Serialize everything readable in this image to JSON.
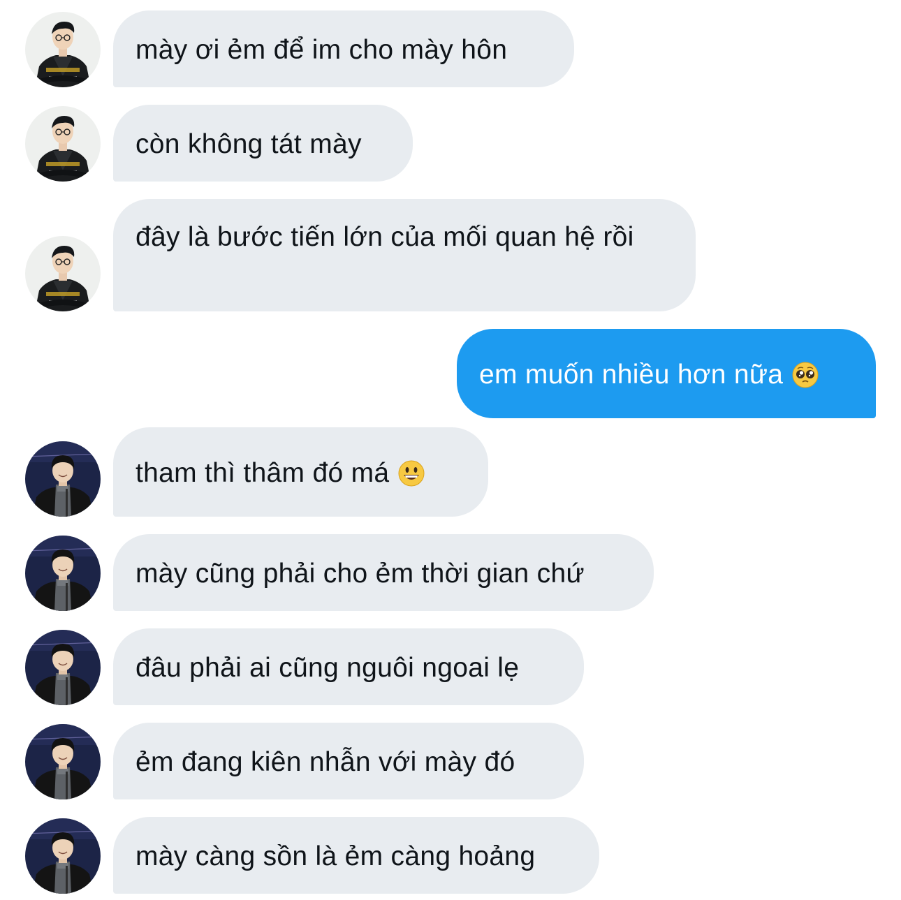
{
  "conversation": {
    "messages": [
      {
        "sender": "contact-a",
        "text": "mày ơi ẻm để im cho mày hôn"
      },
      {
        "sender": "contact-a",
        "text": "còn không tát mày"
      },
      {
        "sender": "contact-a",
        "text": "đây là bước tiến lớn của mối quan hệ rồi"
      },
      {
        "sender": "self",
        "text": "em muốn nhiều hơn nữa",
        "emoji": "pleading-face-emoji"
      },
      {
        "sender": "contact-b",
        "text": "tham thì thâm đó má",
        "emoji": "grinning-face-emoji"
      },
      {
        "sender": "contact-b",
        "text": "mày cũng phải cho ẻm thời gian chứ"
      },
      {
        "sender": "contact-b",
        "text": "đâu phải ai cũng nguôi ngoai lẹ"
      },
      {
        "sender": "contact-b",
        "text": "ẻm đang kiên nhẫn với mày đó"
      },
      {
        "sender": "contact-b",
        "text": "mày càng sồn là ẻm càng hoảng"
      }
    ]
  },
  "colors": {
    "incoming_bubble": "#e8ecf0",
    "outgoing_bubble": "#1d9bf0",
    "incoming_text": "#0f1419",
    "outgoing_text": "#ffffff"
  }
}
